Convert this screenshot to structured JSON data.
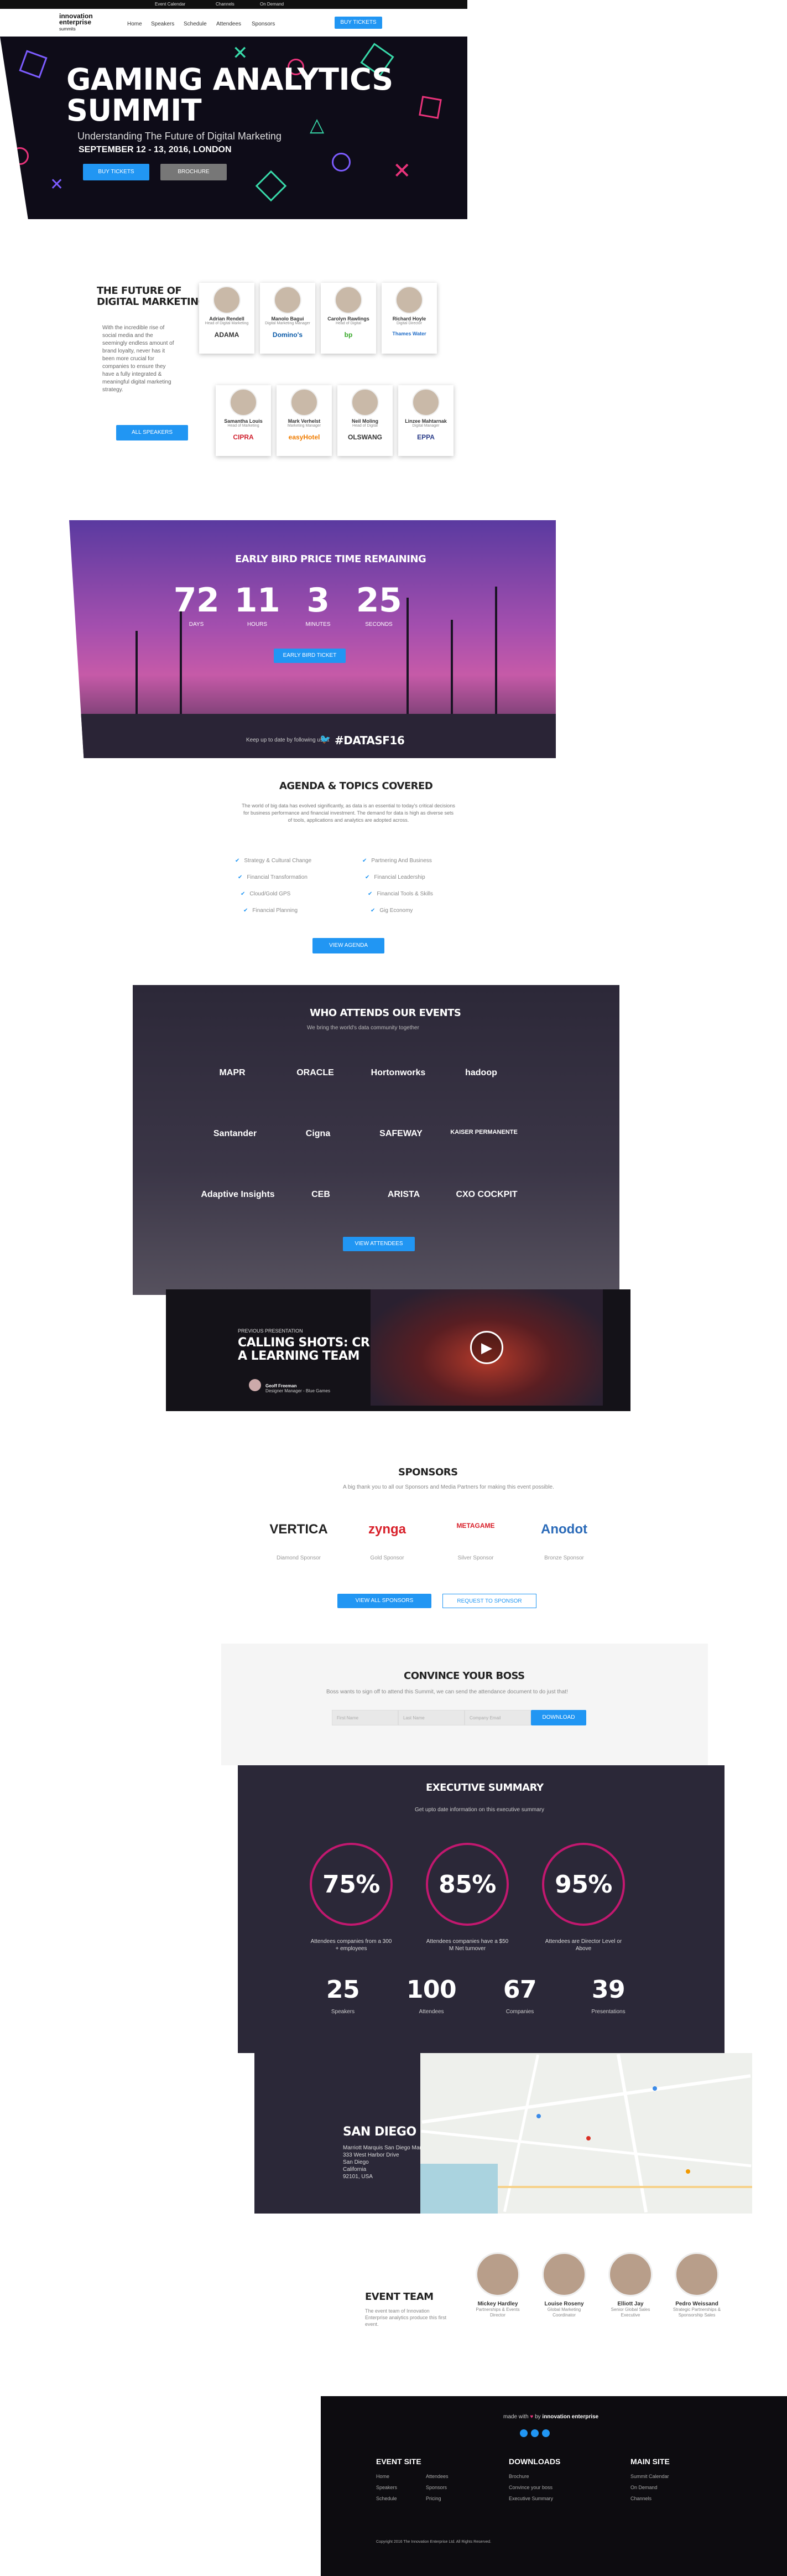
{
  "topbar": {
    "calendar": "Event Calendar",
    "channels": "Channels",
    "on_demand": "On Demand"
  },
  "nav": {
    "logo_line1": "innovation",
    "logo_line2": "enterprise",
    "logo_line3": "summits",
    "items": [
      "Home",
      "Speakers",
      "Schedule",
      "Attendees",
      "Sponsors"
    ],
    "cta": "BUY TICKETS"
  },
  "hero": {
    "title_line1": "GAMING ANALYTICS",
    "title_line2": "SUMMIT",
    "subtitle": "Understanding The Future of Digital Marketing",
    "date": "SEPTEMBER 12 - 13, 2016, LONDON",
    "buy_label": "BUY TICKETS",
    "brochure_label": "BROCHURE",
    "colors": {
      "pink": "#e8337a",
      "green": "#38d9a9",
      "purple": "#7c5cff"
    }
  },
  "future": {
    "heading_line1": "THE FUTURE OF",
    "heading_line2": "DIGITAL MARKETING",
    "body": "With the incredible rise of social media and the seemingly endless amount of brand loyalty, never has it been more crucial for companies to ensure they have a fully integrated & meaningful digital marketing strategy.",
    "button": "ALL SPEAKERS",
    "speakers": [
      {
        "name": "Adrian Rendell",
        "role": "Head of Digital Marketing",
        "company": "ADAMA",
        "company_color": "#333333"
      },
      {
        "name": "Manolo Bagui",
        "role": "Digital Marketing Manager",
        "company": "Domino's",
        "company_color": "#0a5aa8"
      },
      {
        "name": "Carolyn Rawlings",
        "role": "Head of Digital",
        "company": "bp",
        "company_color": "#37a829"
      },
      {
        "name": "Richard Hoyle",
        "role": "Digital Director",
        "company": "Thames Water",
        "company_color": "#1f6cc7"
      },
      {
        "name": "Samantha Louis",
        "role": "Head of Marketing",
        "company": "CIPRA",
        "company_color": "#d0202e"
      },
      {
        "name": "Mark Verhelst",
        "role": "Marketing Manager",
        "company": "easyHotel",
        "company_color": "#f07c00"
      },
      {
        "name": "Neil Moling",
        "role": "Head of Digital",
        "company": "OLSWANG",
        "company_color": "#333333"
      },
      {
        "name": "Linzee Mahtarnak",
        "role": "Digital Manager",
        "company": "EPPA",
        "company_color": "#2c3e8a"
      }
    ]
  },
  "countdown": {
    "heading": "EARLY BIRD PRICE TIME REMAINING",
    "units": [
      {
        "value": "72",
        "label": "DAYS"
      },
      {
        "value": "11",
        "label": "HOURS"
      },
      {
        "value": "3",
        "label": "MINUTES"
      },
      {
        "value": "25",
        "label": "SECONDS"
      }
    ],
    "button": "EARLY BIRD TICKET",
    "footer_text": "Keep up to date by following us at",
    "hashtag": "#DATASF16"
  },
  "agenda": {
    "heading": "AGENDA & TOPICS COVERED",
    "body": "The world of big data has evolved significantly, as data is an essential to today's critical decisions for business performance and financial investment. The demand for data is high as diverse sets of tools, applications and analytics are adopted across.",
    "left": [
      "Strategy & Cultural Change",
      "Financial Transformation",
      "Cloud/Gold GPS",
      "Financial Planning"
    ],
    "right": [
      "Partnering And Business",
      "Financial Leadership",
      "Financial Tools & Skills",
      "Gig Economy"
    ],
    "button": "VIEW AGENDA"
  },
  "attendees": {
    "heading": "WHO ATTENDS OUR EVENTS",
    "subtitle": "We bring the world's data community together",
    "logos": [
      "MAPR",
      "ORACLE",
      "Hortonworks",
      "hadoop",
      "Santander",
      "Cigna",
      "SAFEWAY",
      "KAISER PERMANENTE",
      "Adaptive Insights",
      "CEB",
      "ARISTA",
      "CXO COCKPIT"
    ],
    "button": "VIEW ATTENDEES"
  },
  "presentation": {
    "tag": "PREVIOUS PRESENTATION",
    "title_line1": "CALLING SHOTS: CREATING",
    "title_line2": "A LEARNING TEAM",
    "speaker": "Geoff Freeman",
    "speaker_role": "Designer Manager - Blue Games"
  },
  "sponsors": {
    "heading": "SPONSORS",
    "body": "A big thank you to all our Sponsors and Media Partners for making this event possible.",
    "items": [
      {
        "name": "VERTICA",
        "type": "Diamond Sponsor",
        "color": "#222222"
      },
      {
        "name": "zynga",
        "type": "Gold Sponsor",
        "color": "#d8202a"
      },
      {
        "name": "METAGAME",
        "type": "Silver Sponsor",
        "color": "#d8202a"
      },
      {
        "name": "Anodot",
        "type": "Bronze Sponsor",
        "color": "#2a6ab8"
      }
    ],
    "btn_all": "VIEW ALL SPONSORS",
    "btn_request": "REQUEST TO SPONSOR"
  },
  "convince": {
    "heading": "CONVINCE YOUR BOSS",
    "body": "Boss wants to sign off to attend this Summit, we can send the attendance document to do just that!",
    "inputs": [
      "First Name",
      "Last Name",
      "Company Email"
    ],
    "button": "DOWNLOAD"
  },
  "exec": {
    "heading": "EXECUTIVE SUMMARY",
    "subtitle": "Get upto date information on this executive summary",
    "rings": [
      {
        "value": "75%",
        "label": "Attendees companies from a 300 + employees"
      },
      {
        "value": "85%",
        "label": "Attendees companies have a $50 M Net turnover"
      },
      {
        "value": "95%",
        "label": "Attendees are Director Level or Above"
      }
    ],
    "stats": [
      {
        "value": "25",
        "label": "Speakers"
      },
      {
        "value": "100",
        "label": "Attendees"
      },
      {
        "value": "67",
        "label": "Companies"
      },
      {
        "value": "39",
        "label": "Presentations"
      }
    ],
    "accent": "#c2186f"
  },
  "location": {
    "city": "SAN DIEGO",
    "address": [
      "Marriott Marquis San Diego Marina",
      "333 West Harbor Drive",
      "San Diego",
      "California",
      "92101, USA"
    ]
  },
  "team": {
    "heading": "EVENT TEAM",
    "body": "The event team of Innovation Enterprise analytics produce this first event.",
    "members": [
      {
        "name": "Mickey Hardley",
        "role": "Partnerships & Events Director"
      },
      {
        "name": "Louise Roseny",
        "role": "Global Marketing Coordinator"
      },
      {
        "name": "Elliott Jay",
        "role": "Senior Global Sales Executive"
      },
      {
        "name": "Pedro Weissand",
        "role": "Strategic Partnerships & Sponsorship Sales"
      }
    ]
  },
  "footer": {
    "made_with": "made with",
    "by": "by",
    "brand": "innovation enterprise",
    "cols": [
      {
        "title": "EVENT SITE",
        "links": [
          "Home",
          "Speakers",
          "Schedule",
          "Attendees",
          "Sponsors",
          "Pricing"
        ]
      },
      {
        "title": "DOWNLOADS",
        "links": [
          "Brochure",
          "Convince your boss",
          "Executive Summary"
        ]
      },
      {
        "title": "MAIN SITE",
        "links": [
          "Summit Calendar",
          "On Demand",
          "Channels"
        ]
      }
    ],
    "copyright": "Copyright 2016 The Innovation Enterprise Ltd. All Rights Reserved."
  }
}
